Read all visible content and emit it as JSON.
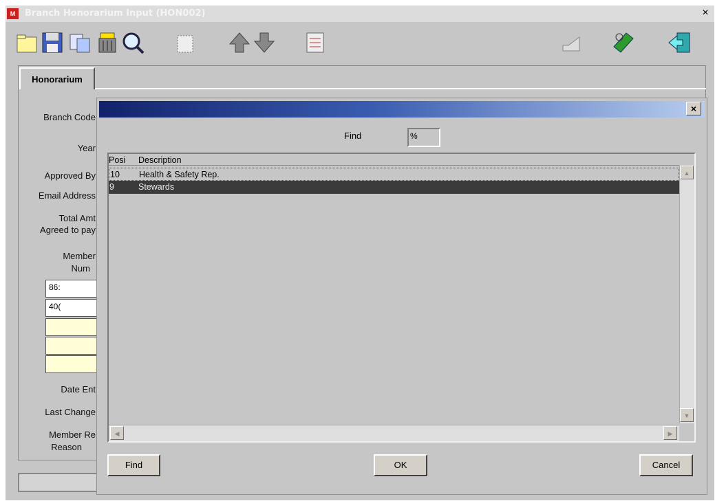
{
  "window": {
    "title": "Branch Honorarium Input (HON002)",
    "app_icon": "app-logo-icon",
    "close_label": "×"
  },
  "toolbar": {
    "icons": [
      "new-icon",
      "save-icon",
      "copy-icon",
      "delete-icon",
      "search-icon",
      "clear-icon",
      "previous-record-icon",
      "next-record-icon",
      "list-icon",
      "print-icon",
      "payment-icon",
      "exit-icon"
    ]
  },
  "tab": {
    "label": "Honorarium"
  },
  "form": {
    "branch_code": "Branch Code",
    "year": "Year",
    "approved_by": "Approved By",
    "email_address": "Email Address",
    "total_amt_line1": "Total Amt",
    "total_amt_line2": "Agreed to pay",
    "member_num_line1": "Member",
    "member_num_line2": "Num",
    "member_values": [
      "86:",
      "40("
    ],
    "date_entered": "Date Ent",
    "last_changed": "Last Change",
    "member_reason_line1": "Member Re",
    "member_reason_line2": "Reason"
  },
  "dialog": {
    "title": "",
    "close_label": "×",
    "find_label": "Find",
    "find_value": "%",
    "columns": [
      "Posi",
      "Description"
    ],
    "rows": [
      {
        "pos": "10",
        "description": "Health & Safety Rep.",
        "selected": false
      },
      {
        "pos": "9",
        "description": "Stewards",
        "selected": true
      }
    ],
    "buttons": {
      "find": "Find",
      "ok": "OK",
      "cancel": "Cancel"
    }
  },
  "colors": {
    "selection": "#3b3b3b",
    "dialog_title_start": "#12226b",
    "dialog_title_end": "#b8cdee",
    "input_yellow": "#fffed6"
  }
}
